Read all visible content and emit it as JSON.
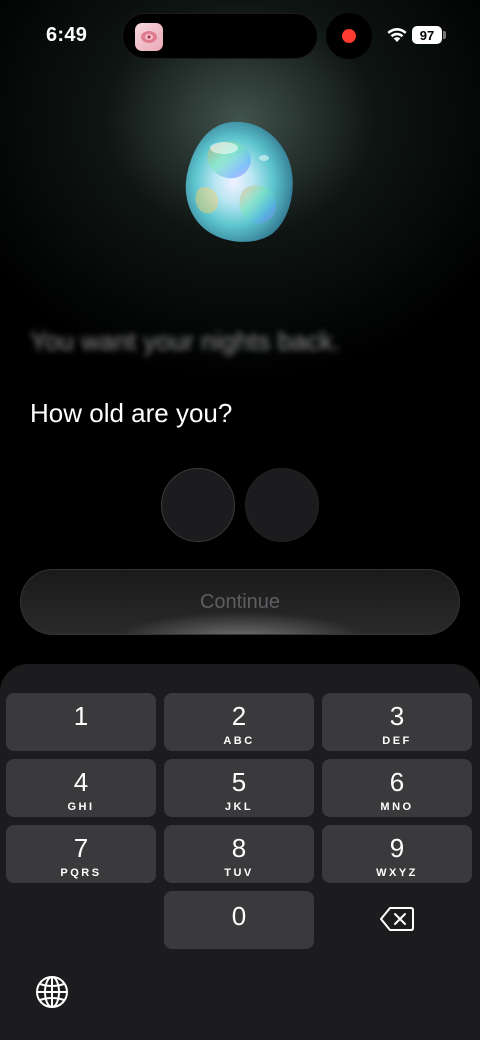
{
  "status_bar": {
    "time": "6:49",
    "battery": "97",
    "record_color": "#ff3b30"
  },
  "onboarding": {
    "blurred_line": "You want your nights back.",
    "question": "How old are you?",
    "continue_label": "Continue"
  },
  "keypad": {
    "keys": [
      {
        "num": "1",
        "letters": ""
      },
      {
        "num": "2",
        "letters": "ABC"
      },
      {
        "num": "3",
        "letters": "DEF"
      },
      {
        "num": "4",
        "letters": "GHI"
      },
      {
        "num": "5",
        "letters": "JKL"
      },
      {
        "num": "6",
        "letters": "MNO"
      },
      {
        "num": "7",
        "letters": "PQRS"
      },
      {
        "num": "8",
        "letters": "TUV"
      },
      {
        "num": "9",
        "letters": "WXYZ"
      },
      {
        "num": "0",
        "letters": ""
      }
    ]
  },
  "icons": {
    "app": "app-icon",
    "wifi": "wifi-icon",
    "backspace": "backspace-icon",
    "globe": "globe-icon"
  }
}
